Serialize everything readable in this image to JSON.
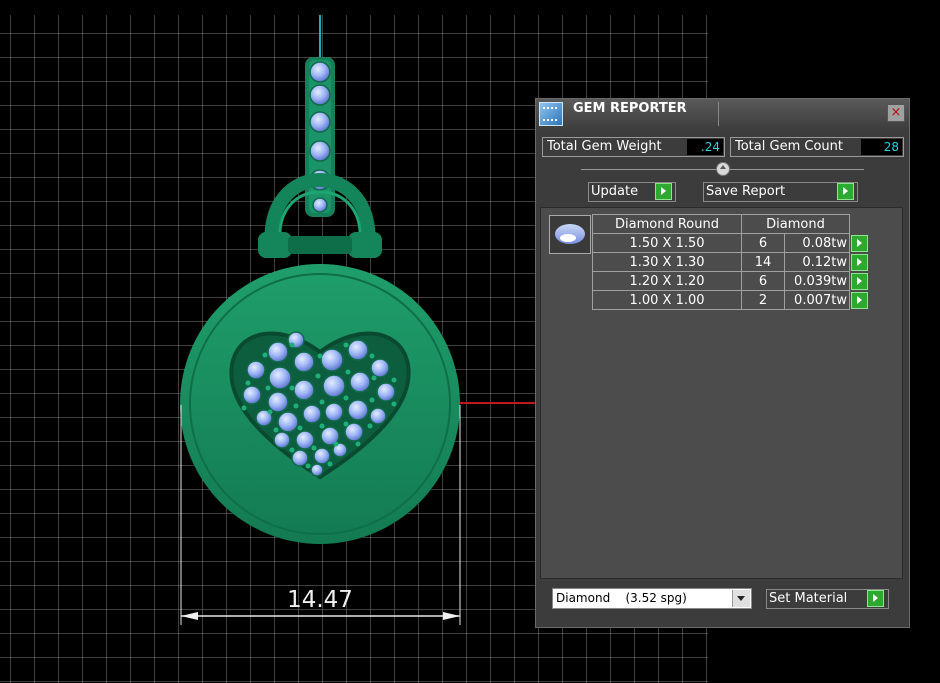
{
  "viewport": {
    "dimension_value": "14.47"
  },
  "gem_reporter": {
    "title": "GEM REPORTER",
    "close_glyph": "×",
    "total_gem_weight_label": "Total Gem Weight",
    "total_gem_weight_value": ".24",
    "total_gem_count_label": "Total Gem Count",
    "total_gem_count_value": "28",
    "update_label": "Update",
    "save_report_label": "Save Report",
    "table_header": {
      "shape": "Diamond Round",
      "material": "Diamond"
    },
    "rows": [
      {
        "size": "1.50 X 1.50",
        "count": "6",
        "weight": "0.08tw"
      },
      {
        "size": "1.30 X 1.30",
        "count": "14",
        "weight": "0.12tw"
      },
      {
        "size": "1.20 X 1.20",
        "count": "6",
        "weight": "0.039tw"
      },
      {
        "size": "1.00 X 1.00",
        "count": "2",
        "weight": "0.007tw"
      }
    ],
    "material_select": "Diamond    (3.52 spg)",
    "set_material_label": "Set Material",
    "accent_value_color": "#2fd1e3",
    "go_button_color": "#2ea82e"
  }
}
